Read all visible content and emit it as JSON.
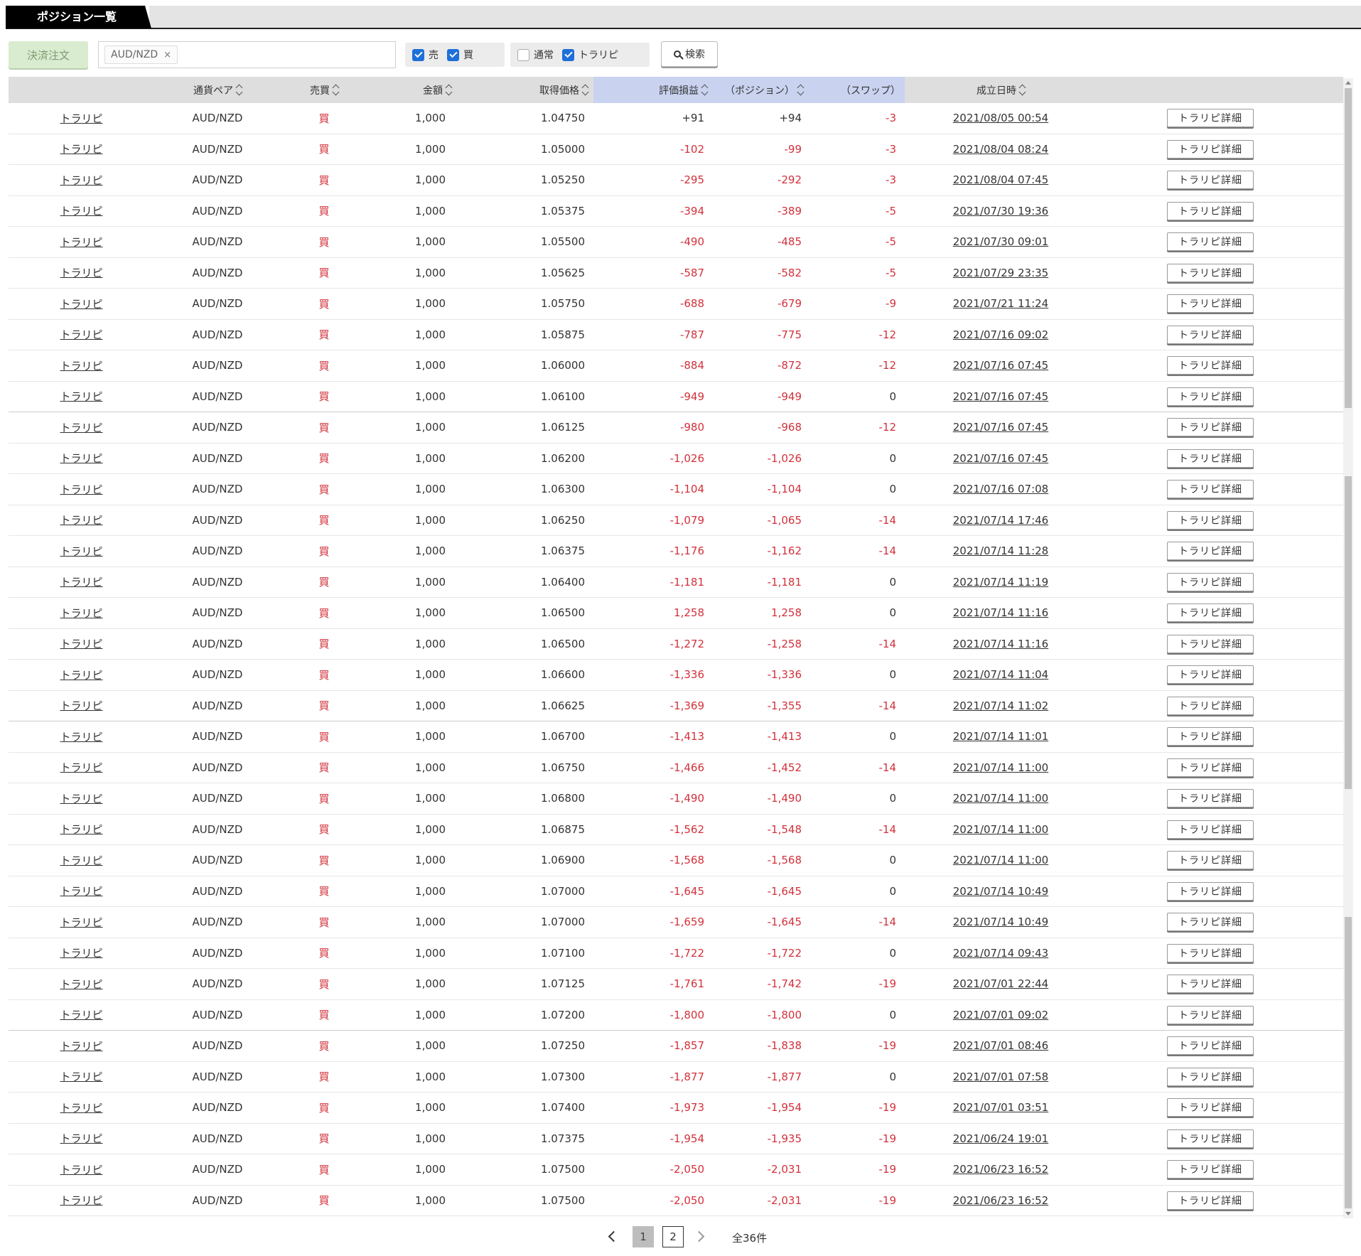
{
  "tab": {
    "title": "ポジション一覧"
  },
  "toolbar": {
    "settle_label": "決済注文",
    "filter_chip": "AUD/NZD",
    "filter_chip_remove": "×",
    "sell_label": "売",
    "sell_checked": true,
    "buy_label": "買",
    "buy_checked": true,
    "normal_label": "通常",
    "normal_checked": false,
    "traripi_label": "トラリピ",
    "traripi_checked": true,
    "search_label": "検索"
  },
  "table": {
    "headers": {
      "order_type": "",
      "pair": "通貨ペア",
      "side": "売買",
      "amount": "金額",
      "price": "取得価格",
      "pl": "評価損益",
      "position": "（ポジション）",
      "swap": "（スワップ）",
      "date": "成立日時"
    },
    "detail_button_label": "トラリピ詳細",
    "rows": [
      {
        "type": "トラリピ",
        "pair": "AUD/NZD",
        "side": "買",
        "amount": "1,000",
        "price": "1.04750",
        "pl": "+91",
        "position": "+94",
        "swap": "-3",
        "date": "2021/08/05 00:54"
      },
      {
        "type": "トラリピ",
        "pair": "AUD/NZD",
        "side": "買",
        "amount": "1,000",
        "price": "1.05000",
        "pl": "-102",
        "position": "-99",
        "swap": "-3",
        "date": "2021/08/04 08:24"
      },
      {
        "type": "トラリピ",
        "pair": "AUD/NZD",
        "side": "買",
        "amount": "1,000",
        "price": "1.05250",
        "pl": "-295",
        "position": "-292",
        "swap": "-3",
        "date": "2021/08/04 07:45"
      },
      {
        "type": "トラリピ",
        "pair": "AUD/NZD",
        "side": "買",
        "amount": "1,000",
        "price": "1.05375",
        "pl": "-394",
        "position": "-389",
        "swap": "-5",
        "date": "2021/07/30 19:36"
      },
      {
        "type": "トラリピ",
        "pair": "AUD/NZD",
        "side": "買",
        "amount": "1,000",
        "price": "1.05500",
        "pl": "-490",
        "position": "-485",
        "swap": "-5",
        "date": "2021/07/30 09:01"
      },
      {
        "type": "トラリピ",
        "pair": "AUD/NZD",
        "side": "買",
        "amount": "1,000",
        "price": "1.05625",
        "pl": "-587",
        "position": "-582",
        "swap": "-5",
        "date": "2021/07/29 23:35"
      },
      {
        "type": "トラリピ",
        "pair": "AUD/NZD",
        "side": "買",
        "amount": "1,000",
        "price": "1.05750",
        "pl": "-688",
        "position": "-679",
        "swap": "-9",
        "date": "2021/07/21 11:24"
      },
      {
        "type": "トラリピ",
        "pair": "AUD/NZD",
        "side": "買",
        "amount": "1,000",
        "price": "1.05875",
        "pl": "-787",
        "position": "-775",
        "swap": "-12",
        "date": "2021/07/16 09:02"
      },
      {
        "type": "トラリピ",
        "pair": "AUD/NZD",
        "side": "買",
        "amount": "1,000",
        "price": "1.06000",
        "pl": "-884",
        "position": "-872",
        "swap": "-12",
        "date": "2021/07/16 07:45"
      },
      {
        "type": "トラリピ",
        "pair": "AUD/NZD",
        "side": "買",
        "amount": "1,000",
        "price": "1.06100",
        "pl": "-949",
        "position": "-949",
        "swap": "0",
        "date": "2021/07/16 07:45"
      },
      {
        "type": "トラリピ",
        "pair": "AUD/NZD",
        "side": "買",
        "amount": "1,000",
        "price": "1.06125",
        "pl": "-980",
        "position": "-968",
        "swap": "-12",
        "date": "2021/07/16 07:45"
      },
      {
        "type": "トラリピ",
        "pair": "AUD/NZD",
        "side": "買",
        "amount": "1,000",
        "price": "1.06200",
        "pl": "-1,026",
        "position": "-1,026",
        "swap": "0",
        "date": "2021/07/16 07:45"
      },
      {
        "type": "トラリピ",
        "pair": "AUD/NZD",
        "side": "買",
        "amount": "1,000",
        "price": "1.06300",
        "pl": "-1,104",
        "position": "-1,104",
        "swap": "0",
        "date": "2021/07/16 07:08"
      },
      {
        "type": "トラリピ",
        "pair": "AUD/NZD",
        "side": "買",
        "amount": "1,000",
        "price": "1.06250",
        "pl": "-1,079",
        "position": "-1,065",
        "swap": "-14",
        "date": "2021/07/14 17:46"
      },
      {
        "type": "トラリピ",
        "pair": "AUD/NZD",
        "side": "買",
        "amount": "1,000",
        "price": "1.06375",
        "pl": "-1,176",
        "position": "-1,162",
        "swap": "-14",
        "date": "2021/07/14 11:28"
      },
      {
        "type": "トラリピ",
        "pair": "AUD/NZD",
        "side": "買",
        "amount": "1,000",
        "price": "1.06400",
        "pl": "-1,181",
        "position": "-1,181",
        "swap": "0",
        "date": "2021/07/14 11:19"
      },
      {
        "type": "トラリピ",
        "pair": "AUD/NZD",
        "side": "買",
        "amount": "1,000",
        "price": "1.06500",
        "pl": "1,258",
        "position": "1,258",
        "swap": "0",
        "date": "2021/07/14 11:16"
      },
      {
        "type": "トラリピ",
        "pair": "AUD/NZD",
        "side": "買",
        "amount": "1,000",
        "price": "1.06500",
        "pl": "-1,272",
        "position": "-1,258",
        "swap": "-14",
        "date": "2021/07/14 11:16"
      },
      {
        "type": "トラリピ",
        "pair": "AUD/NZD",
        "side": "買",
        "amount": "1,000",
        "price": "1.06600",
        "pl": "-1,336",
        "position": "-1,336",
        "swap": "0",
        "date": "2021/07/14 11:04"
      },
      {
        "type": "トラリピ",
        "pair": "AUD/NZD",
        "side": "買",
        "amount": "1,000",
        "price": "1.06625",
        "pl": "-1,369",
        "position": "-1,355",
        "swap": "-14",
        "date": "2021/07/14 11:02"
      },
      {
        "type": "トラリピ",
        "pair": "AUD/NZD",
        "side": "買",
        "amount": "1,000",
        "price": "1.06700",
        "pl": "-1,413",
        "position": "-1,413",
        "swap": "0",
        "date": "2021/07/14 11:01"
      },
      {
        "type": "トラリピ",
        "pair": "AUD/NZD",
        "side": "買",
        "amount": "1,000",
        "price": "1.06750",
        "pl": "-1,466",
        "position": "-1,452",
        "swap": "-14",
        "date": "2021/07/14 11:00"
      },
      {
        "type": "トラリピ",
        "pair": "AUD/NZD",
        "side": "買",
        "amount": "1,000",
        "price": "1.06800",
        "pl": "-1,490",
        "position": "-1,490",
        "swap": "0",
        "date": "2021/07/14 11:00"
      },
      {
        "type": "トラリピ",
        "pair": "AUD/NZD",
        "side": "買",
        "amount": "1,000",
        "price": "1.06875",
        "pl": "-1,562",
        "position": "-1,548",
        "swap": "-14",
        "date": "2021/07/14 11:00"
      },
      {
        "type": "トラリピ",
        "pair": "AUD/NZD",
        "side": "買",
        "amount": "1,000",
        "price": "1.06900",
        "pl": "-1,568",
        "position": "-1,568",
        "swap": "0",
        "date": "2021/07/14 11:00"
      },
      {
        "type": "トラリピ",
        "pair": "AUD/NZD",
        "side": "買",
        "amount": "1,000",
        "price": "1.07000",
        "pl": "-1,645",
        "position": "-1,645",
        "swap": "0",
        "date": "2021/07/14 10:49"
      },
      {
        "type": "トラリピ",
        "pair": "AUD/NZD",
        "side": "買",
        "amount": "1,000",
        "price": "1.07000",
        "pl": "-1,659",
        "position": "-1,645",
        "swap": "-14",
        "date": "2021/07/14 10:49"
      },
      {
        "type": "トラリピ",
        "pair": "AUD/NZD",
        "side": "買",
        "amount": "1,000",
        "price": "1.07100",
        "pl": "-1,722",
        "position": "-1,722",
        "swap": "0",
        "date": "2021/07/14 09:43"
      },
      {
        "type": "トラリピ",
        "pair": "AUD/NZD",
        "side": "買",
        "amount": "1,000",
        "price": "1.07125",
        "pl": "-1,761",
        "position": "-1,742",
        "swap": "-19",
        "date": "2021/07/01 22:44"
      },
      {
        "type": "トラリピ",
        "pair": "AUD/NZD",
        "side": "買",
        "amount": "1,000",
        "price": "1.07200",
        "pl": "-1,800",
        "position": "-1,800",
        "swap": "0",
        "date": "2021/07/01 09:02"
      },
      {
        "type": "トラリピ",
        "pair": "AUD/NZD",
        "side": "買",
        "amount": "1,000",
        "price": "1.07250",
        "pl": "-1,857",
        "position": "-1,838",
        "swap": "-19",
        "date": "2021/07/01 08:46"
      },
      {
        "type": "トラリピ",
        "pair": "AUD/NZD",
        "side": "買",
        "amount": "1,000",
        "price": "1.07300",
        "pl": "-1,877",
        "position": "-1,877",
        "swap": "0",
        "date": "2021/07/01 07:58"
      },
      {
        "type": "トラリピ",
        "pair": "AUD/NZD",
        "side": "買",
        "amount": "1,000",
        "price": "1.07400",
        "pl": "-1,973",
        "position": "-1,954",
        "swap": "-19",
        "date": "2021/07/01 03:51"
      },
      {
        "type": "トラリピ",
        "pair": "AUD/NZD",
        "side": "買",
        "amount": "1,000",
        "price": "1.07375",
        "pl": "-1,954",
        "position": "-1,935",
        "swap": "-19",
        "date": "2021/06/24 19:01"
      },
      {
        "type": "トラリピ",
        "pair": "AUD/NZD",
        "side": "買",
        "amount": "1,000",
        "price": "1.07500",
        "pl": "-2,050",
        "position": "-2,031",
        "swap": "-19",
        "date": "2021/06/23 16:52"
      },
      {
        "type": "トラリピ",
        "pair": "AUD/NZD",
        "side": "買",
        "amount": "1,000",
        "price": "1.07500",
        "pl": "-2,050",
        "position": "-2,031",
        "swap": "-19",
        "date": "2021/06/23 16:52"
      }
    ]
  },
  "pagination": {
    "current": "1",
    "next": "2",
    "total": "全36件"
  },
  "colors": {
    "negative": "#d2313b",
    "highlight_header": "#c9d3f0",
    "checkbox": "#1e6fd9",
    "settle_button": "#d9eccf"
  }
}
